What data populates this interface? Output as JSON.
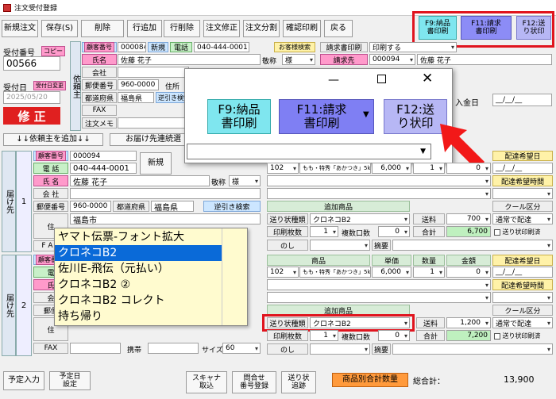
{
  "window": {
    "title": "注文受付登録"
  },
  "toolbar": [
    "新規注文",
    "保存(S)",
    "削除",
    "行追加",
    "行削除",
    "注文修正",
    "注文分割",
    "確認印刷",
    "戻る"
  ],
  "fkeys": {
    "f9": "F9:納品\n書印刷",
    "f11": "F11:請求\n書印刷",
    "f12": "F12:送\nり状印"
  },
  "order": {
    "no_label": "受付番号",
    "copy": "コピー",
    "no": "00566",
    "date_label": "受付日",
    "date_badge": "受付日変更",
    "date": "2025/05/20",
    "status": "修 正"
  },
  "client": {
    "side": "依頼主",
    "cust_label": "顧客番号",
    "cust_no": "000084",
    "new": "新規",
    "tel_label": "電話",
    "tel": "040-444-0001",
    "name_label": "氏名",
    "name": "佐藤 花子",
    "title_label": "敬称",
    "title": "様",
    "company_label": "会社",
    "zip_label": "郵便番号",
    "zip": "960-0000",
    "addr_label": "住所",
    "pref_label": "都道府県",
    "pref": "福島県",
    "reverse": "逆引き検索",
    "fax_label": "FAX",
    "memo_label": "注文メモ",
    "cust_search": "お客様検索"
  },
  "billing": {
    "print_label": "請求書印刷",
    "print_val": "印刷する",
    "to_label": "請求先",
    "cust_no": "000094",
    "name": "佐藤 花子",
    "pay_label": "入金日",
    "pay_val": "__/__/__"
  },
  "bar": {
    "add_client": "↓↓依頼主を追加↓↓",
    "continue": "お届け先連続選"
  },
  "popup": {
    "f9": "F9:納品\n書印刷",
    "f11": "F11:請求\n書印刷",
    "f12": "F12:送\nり状印"
  },
  "dest1": {
    "side": "届け先",
    "row": "1",
    "cust_no": "000094",
    "tel": "040-444-0001",
    "new": "新規",
    "name": "佐藤 花子",
    "title": "様",
    "zip": "960-0000",
    "pref": "福島県",
    "reverse": "逆引き検索",
    "city": "福島市"
  },
  "items1": {
    "code": "102",
    "name": "もも・特秀「あかつき」5kg",
    "price": "6,000",
    "qty": "1",
    "amount": "0",
    "wish_date_label": "配達希望日",
    "wish_date": "__/__/__",
    "wish_time_label": "配達希望時間",
    "add_item": "追加商品",
    "slip_label": "送り状種類",
    "slip": "クロネコB2",
    "ship_label": "送料",
    "ship": "700",
    "cool_label": "クール区分",
    "cool": "通常で配達",
    "print_label": "印刷枚数",
    "print": "1",
    "multi_label": "複数口数",
    "multi": "0",
    "total_label": "合計",
    "total": "6,700",
    "noprint": "送り状印刷済",
    "noshi": "のし",
    "note": "摘要"
  },
  "dropdown": [
    "ヤマト伝票-フォント拡大",
    "クロネコB2",
    "佐川E-飛伝（元払い）",
    "クロネコB2 ②",
    "クロネコB2 コレクト",
    "持ち帰り"
  ],
  "items2": {
    "h_item": "商品",
    "h_price": "単価",
    "h_qty": "数量",
    "h_amount": "金額",
    "wish_date_label": "配達希望日",
    "wish_date": "__/__/__",
    "wish_time_label": "配達希望時間",
    "code": "102",
    "name": "もも・特秀「あかつき」5kg",
    "price": "6,000",
    "qty": "1",
    "amount": "0",
    "add_item": "追加商品",
    "slip_label": "送り状種類",
    "slip": "クロネコB2",
    "ship_label": "送料",
    "ship": "1,200",
    "cool_label": "クール区分",
    "cool": "通常で配達",
    "print_label": "印刷枚数",
    "print": "1",
    "multi_label": "複数口数",
    "multi": "0",
    "total_label": "合計",
    "total": "7,200",
    "noprint": "送り状印刷済",
    "noshi": "のし",
    "note": "摘要"
  },
  "dest2": {
    "side": "届け先",
    "row": "2",
    "fax_label": "FAX",
    "phone_label": "携帯",
    "size_label": "サイズ",
    "size": "60"
  },
  "bottom": {
    "plan": "予定入力",
    "plan_date": "予定日\n設定",
    "scanner": "スキャナ\n取込",
    "inquiry": "問合せ\n番号登録",
    "slip": "送り状\n追跡",
    "per_item": "商品別合計数量",
    "total_label": "総合計：",
    "total": "13,900"
  }
}
